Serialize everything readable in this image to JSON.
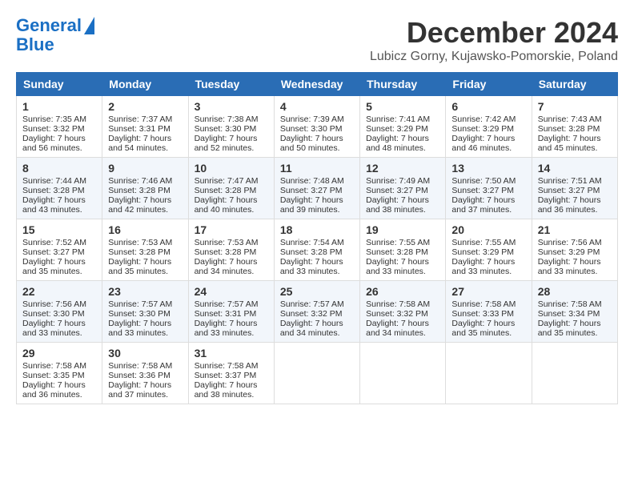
{
  "header": {
    "logo_line1": "General",
    "logo_line2": "Blue",
    "month": "December 2024",
    "location": "Lubicz Gorny, Kujawsko-Pomorskie, Poland"
  },
  "days_of_week": [
    "Sunday",
    "Monday",
    "Tuesday",
    "Wednesday",
    "Thursday",
    "Friday",
    "Saturday"
  ],
  "weeks": [
    [
      {
        "day": "1",
        "sunrise": "Sunrise: 7:35 AM",
        "sunset": "Sunset: 3:32 PM",
        "daylight": "Daylight: 7 hours and 56 minutes."
      },
      {
        "day": "2",
        "sunrise": "Sunrise: 7:37 AM",
        "sunset": "Sunset: 3:31 PM",
        "daylight": "Daylight: 7 hours and 54 minutes."
      },
      {
        "day": "3",
        "sunrise": "Sunrise: 7:38 AM",
        "sunset": "Sunset: 3:30 PM",
        "daylight": "Daylight: 7 hours and 52 minutes."
      },
      {
        "day": "4",
        "sunrise": "Sunrise: 7:39 AM",
        "sunset": "Sunset: 3:30 PM",
        "daylight": "Daylight: 7 hours and 50 minutes."
      },
      {
        "day": "5",
        "sunrise": "Sunrise: 7:41 AM",
        "sunset": "Sunset: 3:29 PM",
        "daylight": "Daylight: 7 hours and 48 minutes."
      },
      {
        "day": "6",
        "sunrise": "Sunrise: 7:42 AM",
        "sunset": "Sunset: 3:29 PM",
        "daylight": "Daylight: 7 hours and 46 minutes."
      },
      {
        "day": "7",
        "sunrise": "Sunrise: 7:43 AM",
        "sunset": "Sunset: 3:28 PM",
        "daylight": "Daylight: 7 hours and 45 minutes."
      }
    ],
    [
      {
        "day": "8",
        "sunrise": "Sunrise: 7:44 AM",
        "sunset": "Sunset: 3:28 PM",
        "daylight": "Daylight: 7 hours and 43 minutes."
      },
      {
        "day": "9",
        "sunrise": "Sunrise: 7:46 AM",
        "sunset": "Sunset: 3:28 PM",
        "daylight": "Daylight: 7 hours and 42 minutes."
      },
      {
        "day": "10",
        "sunrise": "Sunrise: 7:47 AM",
        "sunset": "Sunset: 3:28 PM",
        "daylight": "Daylight: 7 hours and 40 minutes."
      },
      {
        "day": "11",
        "sunrise": "Sunrise: 7:48 AM",
        "sunset": "Sunset: 3:27 PM",
        "daylight": "Daylight: 7 hours and 39 minutes."
      },
      {
        "day": "12",
        "sunrise": "Sunrise: 7:49 AM",
        "sunset": "Sunset: 3:27 PM",
        "daylight": "Daylight: 7 hours and 38 minutes."
      },
      {
        "day": "13",
        "sunrise": "Sunrise: 7:50 AM",
        "sunset": "Sunset: 3:27 PM",
        "daylight": "Daylight: 7 hours and 37 minutes."
      },
      {
        "day": "14",
        "sunrise": "Sunrise: 7:51 AM",
        "sunset": "Sunset: 3:27 PM",
        "daylight": "Daylight: 7 hours and 36 minutes."
      }
    ],
    [
      {
        "day": "15",
        "sunrise": "Sunrise: 7:52 AM",
        "sunset": "Sunset: 3:27 PM",
        "daylight": "Daylight: 7 hours and 35 minutes."
      },
      {
        "day": "16",
        "sunrise": "Sunrise: 7:53 AM",
        "sunset": "Sunset: 3:28 PM",
        "daylight": "Daylight: 7 hours and 35 minutes."
      },
      {
        "day": "17",
        "sunrise": "Sunrise: 7:53 AM",
        "sunset": "Sunset: 3:28 PM",
        "daylight": "Daylight: 7 hours and 34 minutes."
      },
      {
        "day": "18",
        "sunrise": "Sunrise: 7:54 AM",
        "sunset": "Sunset: 3:28 PM",
        "daylight": "Daylight: 7 hours and 33 minutes."
      },
      {
        "day": "19",
        "sunrise": "Sunrise: 7:55 AM",
        "sunset": "Sunset: 3:28 PM",
        "daylight": "Daylight: 7 hours and 33 minutes."
      },
      {
        "day": "20",
        "sunrise": "Sunrise: 7:55 AM",
        "sunset": "Sunset: 3:29 PM",
        "daylight": "Daylight: 7 hours and 33 minutes."
      },
      {
        "day": "21",
        "sunrise": "Sunrise: 7:56 AM",
        "sunset": "Sunset: 3:29 PM",
        "daylight": "Daylight: 7 hours and 33 minutes."
      }
    ],
    [
      {
        "day": "22",
        "sunrise": "Sunrise: 7:56 AM",
        "sunset": "Sunset: 3:30 PM",
        "daylight": "Daylight: 7 hours and 33 minutes."
      },
      {
        "day": "23",
        "sunrise": "Sunrise: 7:57 AM",
        "sunset": "Sunset: 3:30 PM",
        "daylight": "Daylight: 7 hours and 33 minutes."
      },
      {
        "day": "24",
        "sunrise": "Sunrise: 7:57 AM",
        "sunset": "Sunset: 3:31 PM",
        "daylight": "Daylight: 7 hours and 33 minutes."
      },
      {
        "day": "25",
        "sunrise": "Sunrise: 7:57 AM",
        "sunset": "Sunset: 3:32 PM",
        "daylight": "Daylight: 7 hours and 34 minutes."
      },
      {
        "day": "26",
        "sunrise": "Sunrise: 7:58 AM",
        "sunset": "Sunset: 3:32 PM",
        "daylight": "Daylight: 7 hours and 34 minutes."
      },
      {
        "day": "27",
        "sunrise": "Sunrise: 7:58 AM",
        "sunset": "Sunset: 3:33 PM",
        "daylight": "Daylight: 7 hours and 35 minutes."
      },
      {
        "day": "28",
        "sunrise": "Sunrise: 7:58 AM",
        "sunset": "Sunset: 3:34 PM",
        "daylight": "Daylight: 7 hours and 35 minutes."
      }
    ],
    [
      {
        "day": "29",
        "sunrise": "Sunrise: 7:58 AM",
        "sunset": "Sunset: 3:35 PM",
        "daylight": "Daylight: 7 hours and 36 minutes."
      },
      {
        "day": "30",
        "sunrise": "Sunrise: 7:58 AM",
        "sunset": "Sunset: 3:36 PM",
        "daylight": "Daylight: 7 hours and 37 minutes."
      },
      {
        "day": "31",
        "sunrise": "Sunrise: 7:58 AM",
        "sunset": "Sunset: 3:37 PM",
        "daylight": "Daylight: 7 hours and 38 minutes."
      },
      null,
      null,
      null,
      null
    ]
  ]
}
